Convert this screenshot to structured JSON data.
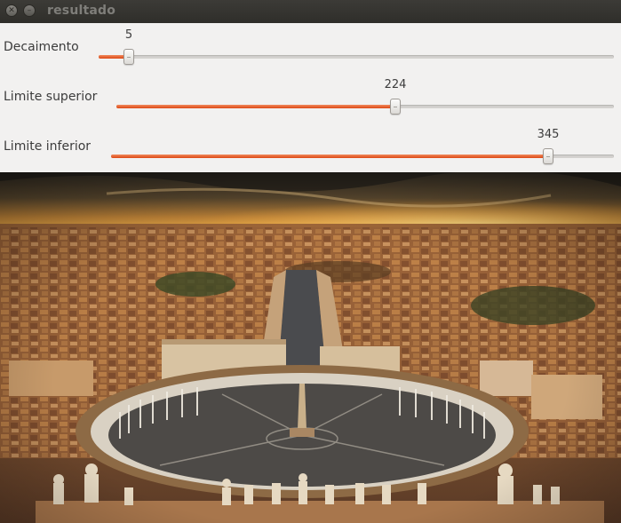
{
  "window": {
    "title": "resultado",
    "close_icon": "close-icon",
    "minimize_icon": "minimize-icon"
  },
  "sliders": [
    {
      "label": "Decaimento",
      "value": "5",
      "fraction": 0.058,
      "accent": "#dd4814"
    },
    {
      "label": "Limite superior",
      "value": "224",
      "fraction": 0.56,
      "accent": "#dd4814"
    },
    {
      "label": "Limite inferior",
      "value": "345",
      "fraction": 0.87,
      "accent": "#dd4814"
    }
  ],
  "image": {
    "subject": "aerial city square photograph"
  }
}
